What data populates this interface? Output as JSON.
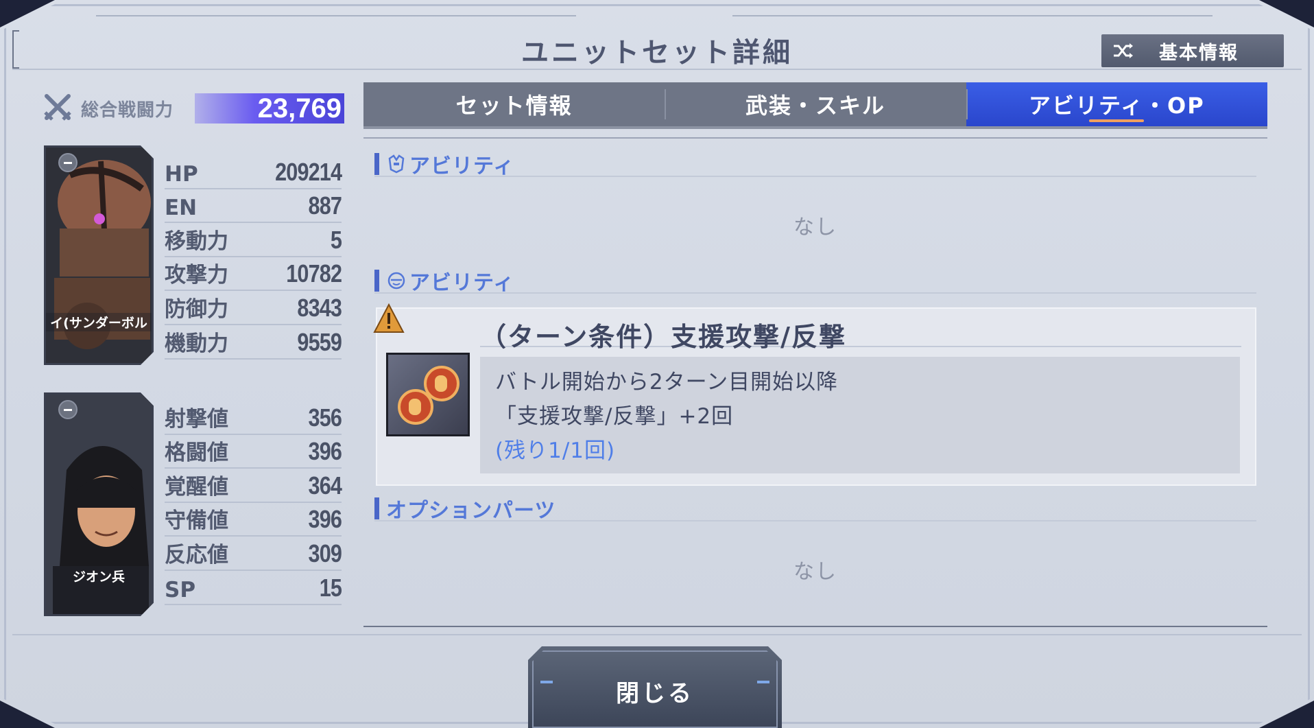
{
  "window": {
    "title": "ユニットセット詳細"
  },
  "header": {
    "basic_info_label": "基本情報",
    "basic_info_icon": "shuffle-icon"
  },
  "power": {
    "label": "総合戦闘力",
    "value": "23,769",
    "icon": "crossed-swords-icon"
  },
  "unit": {
    "name": "イ(サンダーボル",
    "stats": [
      {
        "label": "HP",
        "value": "209214"
      },
      {
        "label": "EN",
        "value": "887"
      },
      {
        "label": "移動力",
        "value": "5"
      },
      {
        "label": "攻撃力",
        "value": "10782"
      },
      {
        "label": "防御力",
        "value": "8343"
      },
      {
        "label": "機動力",
        "value": "9559"
      }
    ]
  },
  "pilot": {
    "name": "ジオン兵",
    "stats": [
      {
        "label": "射撃値",
        "value": "356"
      },
      {
        "label": "格闘値",
        "value": "396"
      },
      {
        "label": "覚醒値",
        "value": "364"
      },
      {
        "label": "守備値",
        "value": "396"
      },
      {
        "label": "反応値",
        "value": "309"
      },
      {
        "label": "SP",
        "value": "15"
      }
    ]
  },
  "tabs": [
    {
      "label": "セット情報",
      "active": false
    },
    {
      "label": "武装・スキル",
      "active": false
    },
    {
      "label": "アビリティ・OP",
      "active": true
    }
  ],
  "sections": {
    "unit_ability": {
      "title": "アビリティ",
      "empty": "なし"
    },
    "pilot_ability": {
      "title": "アビリティ",
      "item": {
        "name": "（ターン条件）支援攻撃/反撃",
        "desc_line1": "バトル開始から2ターン目開始以降",
        "desc_line2": "「支援攻撃/反撃」+2回",
        "remaining": "(残り1/1回)"
      }
    },
    "option_parts": {
      "title": "オプションパーツ",
      "empty": "なし"
    }
  },
  "footer": {
    "close_label": "閉じる"
  },
  "colors": {
    "accent": "#3a5ee6",
    "section_title": "#5478d8",
    "power_bar": "#6a5cf0",
    "remaining": "#4f7ee8"
  }
}
